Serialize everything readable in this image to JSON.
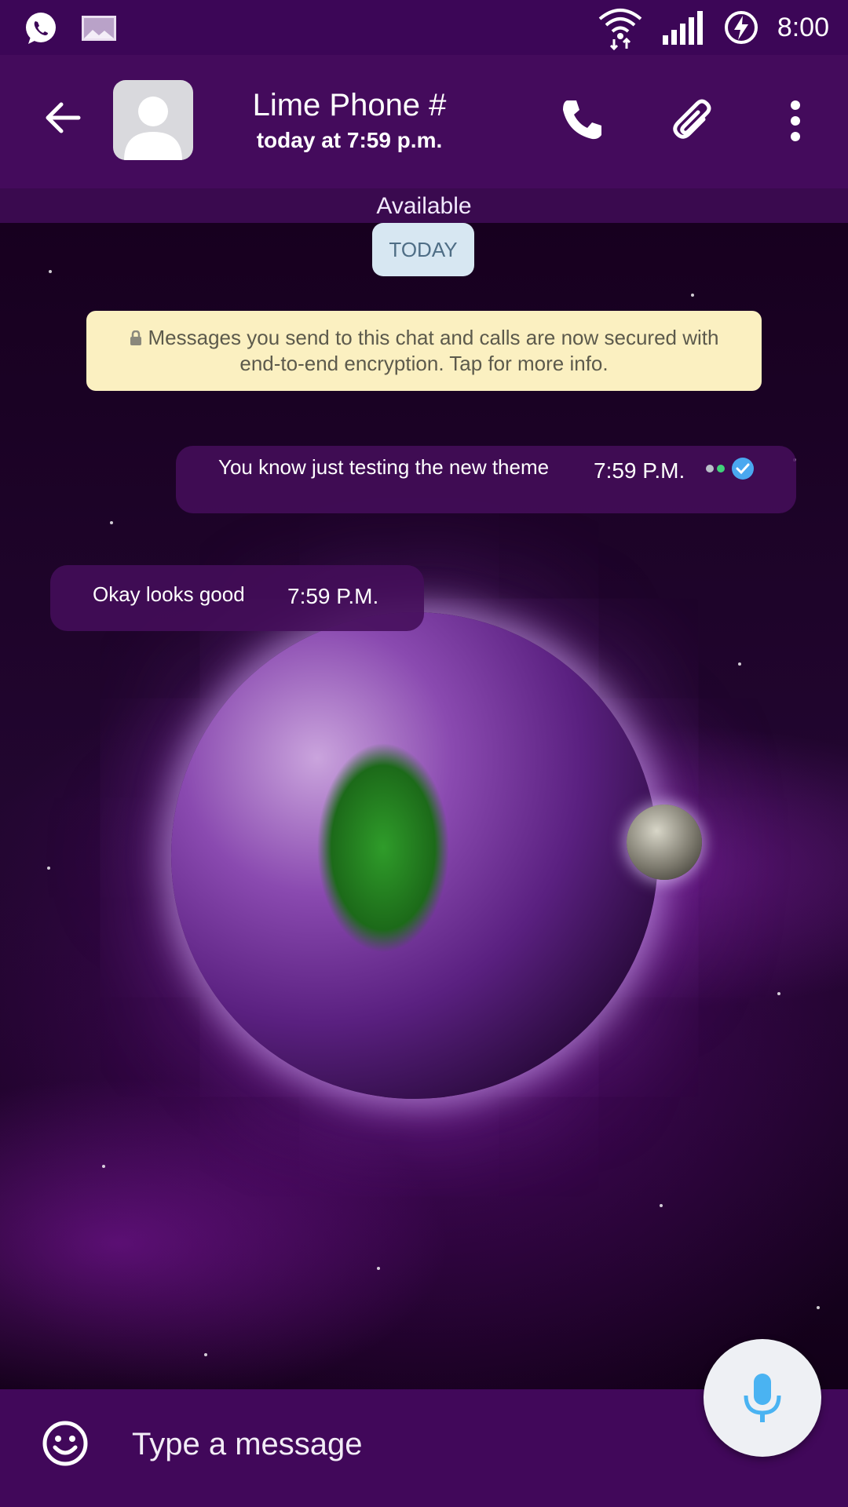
{
  "status_bar": {
    "time": "8:00",
    "icons": [
      "whatsapp-icon",
      "image-icon",
      "wifi-icon",
      "signal-icon",
      "battery-charging-icon"
    ]
  },
  "header": {
    "contact_name": "Lime Phone #",
    "last_seen": "today at 7:59 p.m.",
    "status": "Available",
    "actions": [
      "back-arrow-icon",
      "call-icon",
      "attach-icon",
      "more-vert-icon"
    ]
  },
  "chat": {
    "date_label": "TODAY",
    "encryption_notice": "Messages you send to this chat and calls are now secured with end-to-end encryption. Tap for more info.",
    "messages": [
      {
        "direction": "outgoing",
        "text": "You know just testing the new theme",
        "time": "7:59 P.M.",
        "status": "read"
      },
      {
        "direction": "incoming",
        "text": "Okay looks good",
        "time": "7:59 P.M."
      }
    ]
  },
  "composer": {
    "placeholder": "Type a message",
    "value": ""
  },
  "colors": {
    "status_bar": "#3c0657",
    "app_bar": "#440b5c",
    "bubble": "#440e5a",
    "notice_bg": "#fbf0c1",
    "date_chip_bg": "#d7e7f2",
    "tick_blue": "#4aa8f0",
    "mic_blue": "#4ab3f2"
  }
}
